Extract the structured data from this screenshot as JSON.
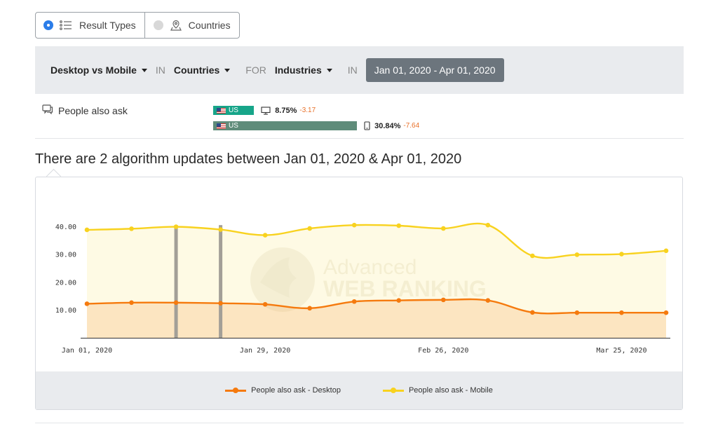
{
  "toggles": {
    "result_types": "Result Types",
    "countries": "Countries"
  },
  "filters": {
    "dimension": "Desktop vs Mobile",
    "kw_in_1": "IN",
    "location": "Countries",
    "kw_for": "FOR",
    "segment": "Industries",
    "kw_in_2": "IN",
    "date_range": "Jan 01, 2020 - Apr 01, 2020"
  },
  "feature": {
    "name": "People also ask",
    "desktop": {
      "country": "US",
      "value": "8.75%",
      "delta": "-3.17",
      "share": 8.75,
      "color": "#17a589"
    },
    "mobile": {
      "country": "US",
      "value": "30.84%",
      "delta": "-7.64",
      "share": 30.84,
      "color": "#5f8c7a"
    }
  },
  "headline": "There are 2 algorithm updates between Jan 01, 2020 & Apr 01, 2020",
  "watermark": {
    "line1": "Advanced",
    "line2": "WEB RANKING"
  },
  "colors": {
    "desktop": "#f57a0e",
    "mobile": "#f8d21f",
    "update_marker": "#a39f97",
    "delta": "#e8712a"
  },
  "chart_data": {
    "type": "area",
    "x": [
      "Jan 01, 2020",
      "Jan 08, 2020",
      "Jan 15, 2020",
      "Jan 22, 2020",
      "Jan 29, 2020",
      "Feb 05, 2020",
      "Feb 12, 2020",
      "Feb 19, 2020",
      "Feb 26, 2020",
      "Mar 04, 2020",
      "Mar 11, 2020",
      "Mar 18, 2020",
      "Mar 25, 2020",
      "Apr 01, 2020"
    ],
    "x_ticks": [
      "Jan 01, 2020",
      "Jan 29, 2020",
      "Feb 26, 2020",
      "Mar 25, 2020"
    ],
    "y_ticks": [
      "10.00",
      "20.00",
      "30.00",
      "40.00"
    ],
    "ylim": [
      0,
      50
    ],
    "series": [
      {
        "name": "People also ask - Desktop",
        "values": [
          12.2,
          12.6,
          12.6,
          12.4,
          12.0,
          10.6,
          13.0,
          13.4,
          13.6,
          13.4,
          9.1,
          9.0,
          9.0,
          9.0
        ]
      },
      {
        "name": "People also ask - Mobile",
        "values": [
          38.7,
          39.1,
          39.8,
          38.8,
          36.8,
          39.2,
          40.4,
          40.2,
          39.2,
          40.4,
          29.4,
          29.8,
          30.0,
          31.2
        ]
      }
    ],
    "algorithm_updates": [
      "Jan 15, 2020",
      "Jan 22, 2020"
    ],
    "legend": "bottom-center",
    "grid": false
  }
}
